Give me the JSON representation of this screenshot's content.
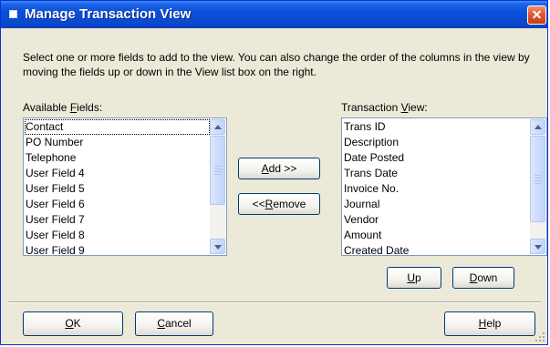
{
  "window": {
    "title": "Manage Transaction View"
  },
  "instructions": "Select one or more fields to add to the view. You can also change the order of the columns in the view by moving the fields up or down in the View list box on the right.",
  "available_fields": {
    "label_pre": "Available ",
    "label_mnemonic": "F",
    "label_post": "ields:",
    "items": [
      "Contact",
      "PO Number",
      "Telephone",
      "User Field  4",
      "User Field  5",
      "User Field  6",
      "User Field  7",
      "User Field  8",
      "User Field  9"
    ],
    "focused_item": "Contact"
  },
  "transaction_view": {
    "label_pre": "Transaction ",
    "label_mnemonic": "V",
    "label_post": "iew:",
    "items": [
      "Trans ID",
      "Description",
      "Date Posted",
      "Trans Date",
      "Invoice No.",
      "Journal",
      "Vendor",
      "Amount",
      "Created Date"
    ]
  },
  "buttons": {
    "add": {
      "mnemonic": "A",
      "rest": "dd >>"
    },
    "remove": {
      "pre": "<< ",
      "mnemonic": "R",
      "rest": "emove"
    },
    "up": {
      "mnemonic": "U",
      "rest": "p"
    },
    "down": {
      "mnemonic": "D",
      "rest": "own"
    },
    "ok": {
      "mnemonic": "O",
      "rest": "K"
    },
    "cancel": {
      "mnemonic": "C",
      "rest": "ancel"
    },
    "help": {
      "mnemonic": "H",
      "rest": "elp"
    }
  },
  "colors": {
    "titlebar": "#0A4AD0",
    "dialog_bg": "#ECE9D8",
    "list_border": "#7F9DB9",
    "button_border": "#003C74"
  },
  "icons": {
    "system_menu": "system-menu-icon",
    "close": "close-icon",
    "scroll_up": "scroll-up-arrow-icon",
    "scroll_down": "scroll-down-arrow-icon",
    "resize_grip": "resize-grip-icon"
  }
}
